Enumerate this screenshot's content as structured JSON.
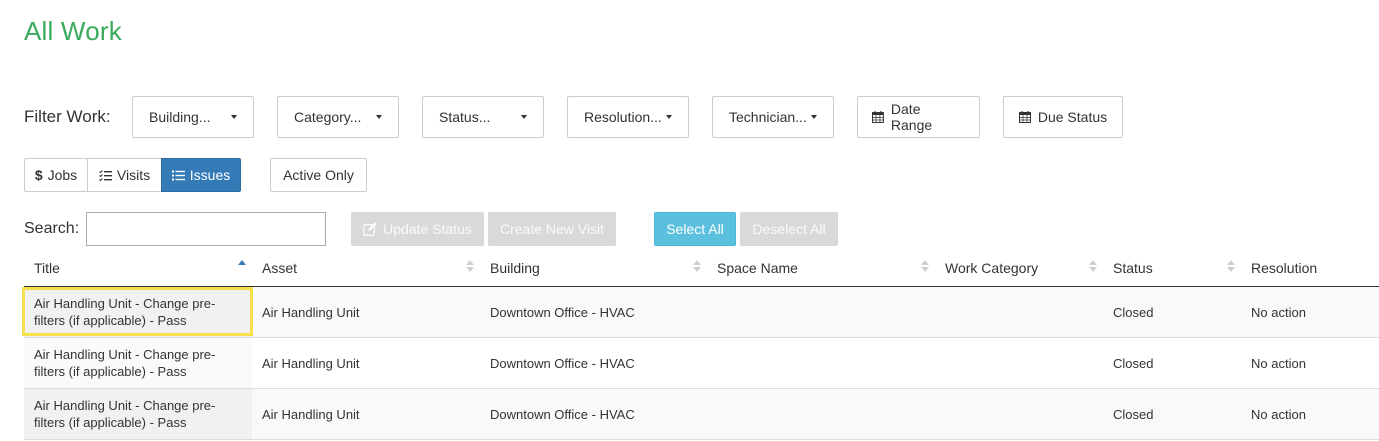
{
  "page": {
    "title": "All Work"
  },
  "filters": {
    "label": "Filter Work:",
    "dropdowns": [
      {
        "label": "Building..."
      },
      {
        "label": "Category..."
      },
      {
        "label": "Status..."
      },
      {
        "label": "Resolution..."
      },
      {
        "label": "Technician..."
      }
    ],
    "date_range": "Date Range",
    "due_status": "Due Status"
  },
  "view_tabs": {
    "jobs": "Jobs",
    "visits": "Visits",
    "issues": "Issues",
    "active": "Issues"
  },
  "active_only": "Active Only",
  "search": {
    "label": "Search:",
    "value": "",
    "placeholder": ""
  },
  "actions": {
    "update_status": "Update Status",
    "create_visit": "Create New Visit",
    "select_all": "Select All",
    "deselect_all": "Deselect All"
  },
  "table": {
    "columns": [
      "Title",
      "Asset",
      "Building",
      "Space Name",
      "Work Category",
      "Status",
      "Resolution"
    ],
    "sorted_column": "Title",
    "sort_direction": "ascending",
    "rows": [
      {
        "title": "Air Handling Unit - Change pre-filters (if applicable) - Pass",
        "asset": "Air Handling Unit",
        "building": "Downtown Office - HVAC",
        "space": "",
        "category": "",
        "status": "Closed",
        "resolution": "No action"
      },
      {
        "title": "Air Handling Unit - Change pre-filters (if applicable) - Pass",
        "asset": "Air Handling Unit",
        "building": "Downtown Office - HVAC",
        "space": "",
        "category": "",
        "status": "Closed",
        "resolution": "No action"
      },
      {
        "title": "Air Handling Unit - Change pre-filters (if applicable) - Pass",
        "asset": "Air Handling Unit",
        "building": "Downtown Office - HVAC",
        "space": "",
        "category": "",
        "status": "Closed",
        "resolution": "No action"
      }
    ]
  },
  "colors": {
    "title_green": "#3aaa5c",
    "primary_blue": "#337ab7",
    "info_cyan": "#5bc0de",
    "highlight_yellow": "#f5e04a"
  }
}
